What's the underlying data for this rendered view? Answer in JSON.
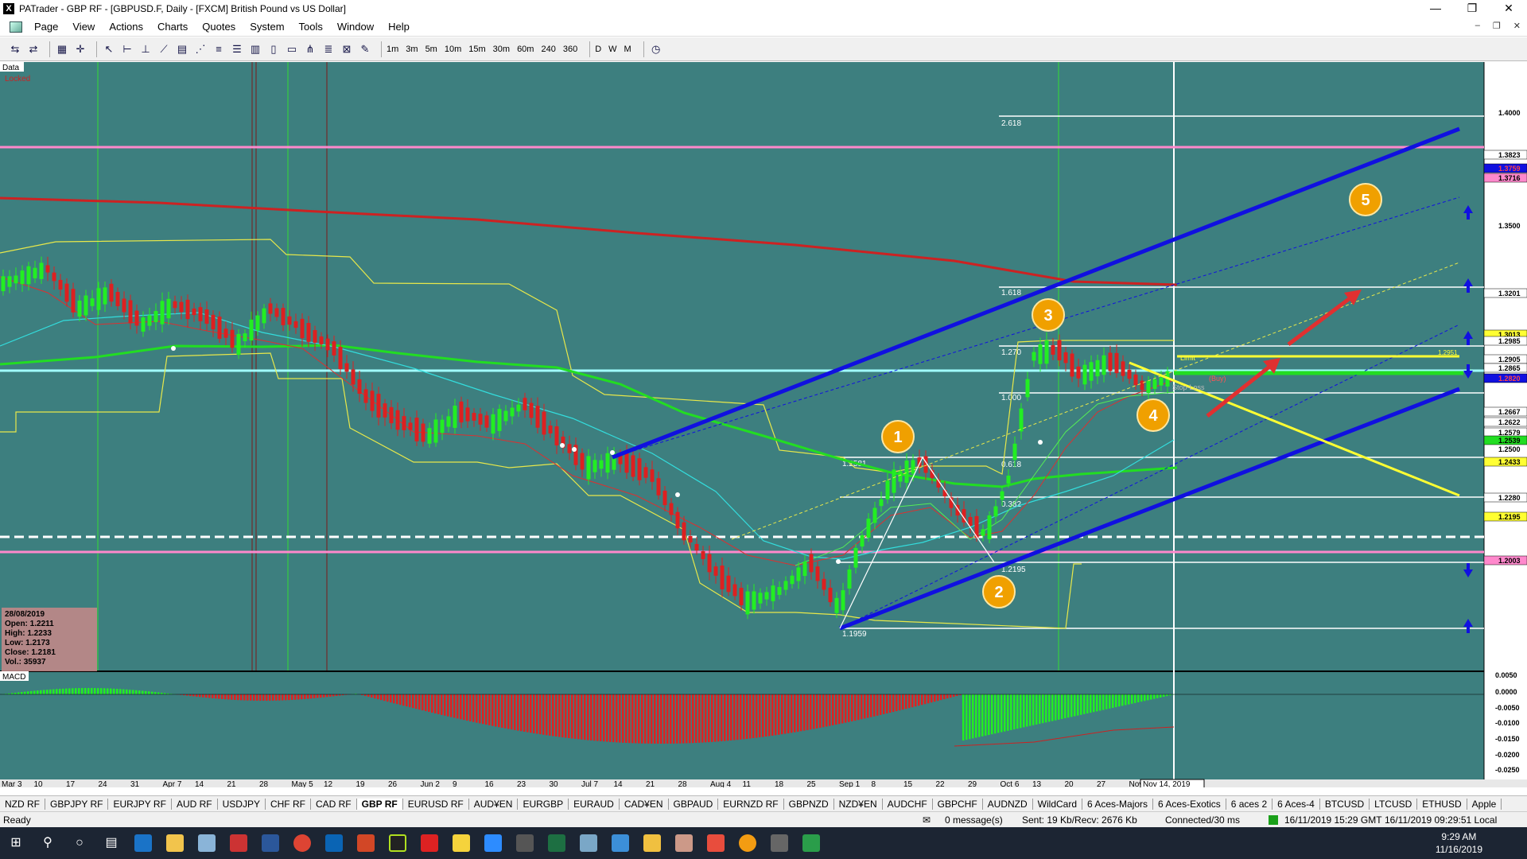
{
  "window": {
    "title": "PATrader - GBP RF - [GBPUSD.F, Daily - [FXCM] British Pound vs US Dollar]",
    "app_icon": "X",
    "minimize": "—",
    "maximize": "❐",
    "close": "✕"
  },
  "menu": {
    "items": [
      "Page",
      "View",
      "Actions",
      "Charts",
      "Quotes",
      "System",
      "Tools",
      "Window",
      "Help"
    ],
    "mdi_min": "–",
    "mdi_restore": "❐",
    "mdi_close": "✕"
  },
  "toolbar": {
    "timeframes": [
      "1m",
      "3m",
      "5m",
      "10m",
      "15m",
      "30m",
      "60m",
      "240",
      "360",
      "D",
      "W",
      "M"
    ]
  },
  "chart": {
    "panel_label": "Data",
    "locked_label": "Locked",
    "index_label": "INDEX",
    "macd_label": "MACD",
    "info_box": {
      "date": "28/08/2019",
      "open": "Open: 1.2211",
      "high": "High: 1.2233",
      "low": "Low: 1.2173",
      "close": "Close: 1.2181",
      "vol": "Vol.: 35937"
    },
    "fib_labels": [
      "2.618",
      "1.618",
      "1.270",
      "1.000",
      "0.618",
      "0.382"
    ],
    "swing_labels": [
      "1.2581",
      "1.2195",
      "1.1959"
    ],
    "trade_labels": {
      "limit": "Limit",
      "order": "(Buy)",
      "stop": "Stop-Loss",
      "level": "1.2951"
    },
    "wave_labels": [
      "1",
      "2",
      "3",
      "4",
      "5"
    ],
    "price_axis": [
      "1.4000",
      "1.3823",
      "1.3759",
      "1.3716",
      "1.3500",
      "1.3201",
      "1.3013",
      "1.2985",
      "1.2905",
      "1.2865",
      "1.2820",
      "1.2667",
      "1.2622",
      "1.2579",
      "1.2539",
      "1.2500",
      "1.2433",
      "1.2280",
      "1.2195",
      "1.2003"
    ],
    "macd_axis": [
      "0.0050",
      "0.0000",
      "-0.0050",
      "-0.0100",
      "-0.0150",
      "-0.0200",
      "-0.0250"
    ],
    "date_axis": [
      "Mar 3",
      "10",
      "17",
      "24",
      "31",
      "Apr 7",
      "14",
      "21",
      "28",
      "May 5",
      "12",
      "19",
      "26",
      "Jun 2",
      "9",
      "16",
      "23",
      "30",
      "Jul 7",
      "14",
      "21",
      "28",
      "Aug 4",
      "11",
      "18",
      "25",
      "Sep 1",
      "8",
      "15",
      "22",
      "29",
      "Oct 6",
      "13",
      "20",
      "27",
      "Nov"
    ],
    "cursor_date": "Nov 14, 2019",
    "colors": {
      "background": "#3d7f7f",
      "channel": "#1010e0",
      "ma_red": "#cc2222",
      "ma_green": "#22dd22",
      "ma_cyan": "#33dddd",
      "fib": "#ffffff",
      "wave_circle": "#f0a000",
      "arrow": "#e03030"
    }
  },
  "tabs": [
    "NZD RF",
    "GBPJPY RF",
    "EURJPY RF",
    "AUD RF",
    "USDJPY",
    "CHF RF",
    "CAD RF",
    "GBP RF",
    "EURUSD RF",
    "AUD¥EN",
    "EURGBP",
    "EURAUD",
    "CAD¥EN",
    "GBPAUD",
    "EURNZD RF",
    "GBPNZD",
    "NZD¥EN",
    "AUDCHF",
    "GBPCHF",
    "AUDNZD",
    "WildCard",
    "6 Aces-Majors",
    "6 Aces-Exotics",
    "6 aces 2",
    "6 Aces-4",
    "BTCUSD",
    "LTCUSD",
    "ETHUSD",
    "Apple"
  ],
  "active_tab": "GBP RF",
  "status": {
    "ready": "Ready",
    "messages": "0 message(s)",
    "traffic": "Sent: 19 Kb/Recv: 2676 Kb",
    "connection": "Connected/30 ms",
    "gmt": "16/11/2019 15:29 GMT",
    "local": "16/11/2019 09:29:51 Local"
  },
  "taskbar": {
    "time": "9:29 AM",
    "date": "11/16/2019"
  }
}
